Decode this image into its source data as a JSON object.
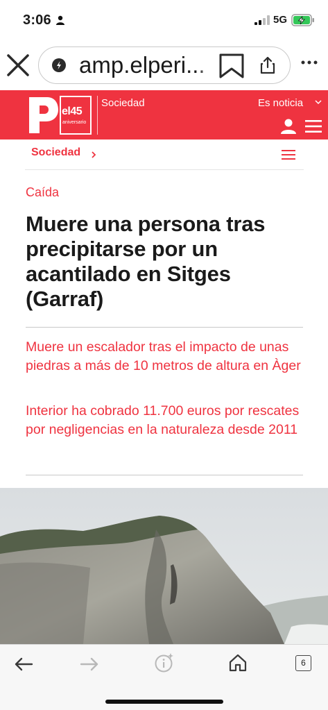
{
  "status": {
    "time": "3:06",
    "network": "5G"
  },
  "browser": {
    "url": "amp.elperi..."
  },
  "site_header": {
    "logo_number": "el45",
    "logo_caption": "aniversario",
    "section": "Sociedad",
    "edition": "Es noticia",
    "brand_color": "#ef3340"
  },
  "breadcrumb": {
    "label": "Sociedad"
  },
  "article": {
    "kicker": "Caída",
    "headline": "Muere una persona tras precipitarse por un acantilado en Sitges (Garraf)",
    "related": [
      "Muere un escalador tras el impacto de unas piedras a más de 10 metros de altura en Àger",
      "Interior ha cobrado 11.700 euros por rescates por negligencias en la naturaleza desde 2011"
    ]
  },
  "toolbar": {
    "tab_count": "6"
  }
}
